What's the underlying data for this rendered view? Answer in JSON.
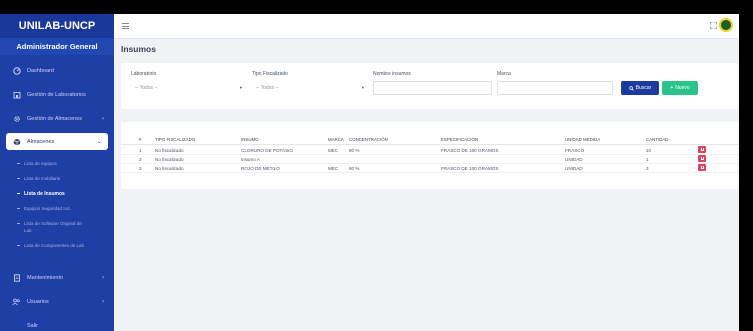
{
  "sidebar": {
    "brand": "UNILAB-UNCP",
    "role": "Administrador General",
    "items": [
      {
        "label": "Dashboard",
        "icon": "dashboard-icon"
      },
      {
        "label": "Gestión de Laboratorios",
        "icon": "building-icon",
        "arrow": "›"
      },
      {
        "label": "Gestión de Almacenes",
        "icon": "gear-icon",
        "arrow": "›"
      },
      {
        "label": "Almacenes",
        "icon": "box-icon",
        "arrow": "⌄"
      }
    ],
    "subitems": [
      "Lista de equipos",
      "Lista de mobiliario",
      "Lista de Insumos",
      "Equipos Seguridad Ind.",
      "Lista de Software Original de Lab",
      "Lista de Componentes de Lab"
    ],
    "bottom_items": [
      {
        "label": "Mantenimiento",
        "icon": "document-icon",
        "arrow": "›"
      },
      {
        "label": "Usuarios",
        "icon": "users-icon",
        "arrow": "›"
      },
      {
        "label": "Salir",
        "icon": "none"
      }
    ]
  },
  "page": {
    "title": "Insumos"
  },
  "filters": {
    "laboratorio_label": "Laboratorio",
    "laboratorio_value": "-- Todos --",
    "tipo_label": "Tipo Fiscalizado",
    "tipo_value": "-- Todos --",
    "nombre_label": "Nombre insumos",
    "marca_label": "Marca",
    "buscar": "Buscar",
    "nuevo": "Nuevo"
  },
  "table": {
    "headers": [
      "#",
      "TIPO FISCALIZADO",
      "INSUMO",
      "MARCA",
      "CONCENTRACIÓN",
      "ESPECIFICACIÓN",
      "UNIDAD MEDIDA",
      "CANTIDAD"
    ],
    "rows": [
      [
        "1",
        "No fiscalizado",
        "CLORURO DE POTASIO",
        "MEC",
        "80 %",
        "FRASCO DE 100 GRAMOS",
        "FRASCO",
        "10"
      ],
      [
        "2",
        "No fiscalizado",
        "insumo A",
        "",
        "",
        "",
        "UNIDAD",
        "1"
      ],
      [
        "3",
        "No fiscalizado",
        "ROJO DE METILO",
        "MEC",
        "80 %",
        "FRASCO DE 100 GRAMOS",
        "UNIDAD",
        "3"
      ]
    ]
  },
  "colors": {
    "sidebar": "#1e3fa6",
    "primary": "#1d3b9c",
    "success": "#29c48a",
    "danger": "#e0435a"
  }
}
